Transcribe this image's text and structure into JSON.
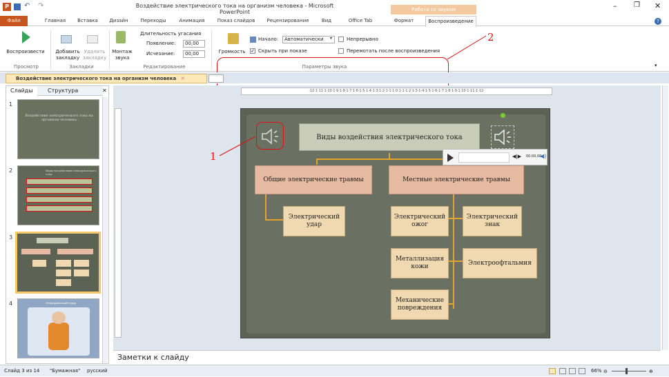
{
  "window": {
    "title": "Воздействие электрического тока на организм человека - Microsoft PowerPoint",
    "context_group": "Работа со звуком"
  },
  "ribbon_tabs": [
    "Файл",
    "Главная",
    "Вставка",
    "Дизайн",
    "Переходы",
    "Анимация",
    "Показ слайдов",
    "Рецензирование",
    "Вид",
    "Office Tab",
    "Формат",
    "Воспроизведение"
  ],
  "ribbon": {
    "play_label": "Воспроизвести",
    "add_bookmark": "Добавить закладку",
    "remove_bookmark": "Удалить закладку",
    "trim_audio": "Монтаж звука",
    "fade_duration": "Длительность угасания",
    "fade_in_label": "Появление:",
    "fade_in_value": "00,00",
    "fade_out_label": "Исчезание:",
    "fade_out_value": "00,00",
    "volume": "Громкость",
    "start_label": "Начало:",
    "start_value": "Автоматически",
    "loop": "Непрерывно",
    "hide_during_show": "Скрыть при показе",
    "rewind": "Перемотать после воспроизведения",
    "groups": {
      "preview": "Просмотр",
      "bookmarks": "Закладки",
      "editing": "Редактирование",
      "audio_options": "Параметры звука"
    }
  },
  "annotations": {
    "one": "1",
    "two": "2"
  },
  "document_tab": "Воздействие электрического тока на организм человека",
  "slides_pane": {
    "tab_slides": "Слайды",
    "tab_outline": "Структура",
    "slide_numbers": [
      "1",
      "2",
      "3",
      "4"
    ],
    "slide1_title": "Воздействие электрического тока на организм человека",
    "slide2_title": "Виды воздействия электрического тока",
    "slide4_title": "Электрический удар"
  },
  "ruler_h": "·12·1·11·1·10·1·9·1·8·1·7·1·6·1·5·1·4·1·3·1·2·1·1·1·0·1·1·1·2·1·3·1·4·1·5·1·6·1·7·1·8·1·9·1·10·1·11·1·12·",
  "slide": {
    "title": "Виды воздействия электрического тока",
    "general": "Общие электрические травмы",
    "local": "Местные электрические травмы",
    "shock": "Электрический удар",
    "burn": "Электрический ожог",
    "sign": "Электрический знак",
    "metal": "Металлизация кожи",
    "ophth": "Электроофтальмия",
    "mech": "Механические повреждения"
  },
  "player": {
    "time": "00:00,00"
  },
  "notes_placeholder": "Заметки к слайду",
  "status": {
    "slide": "Слайд 3 из 14",
    "theme": "\"Бумажная\"",
    "language": "русский",
    "zoom": "66%"
  },
  "colors": {
    "file_tab": "#c8551e",
    "accent_red": "#dd1111",
    "connector": "#e3a42c"
  }
}
